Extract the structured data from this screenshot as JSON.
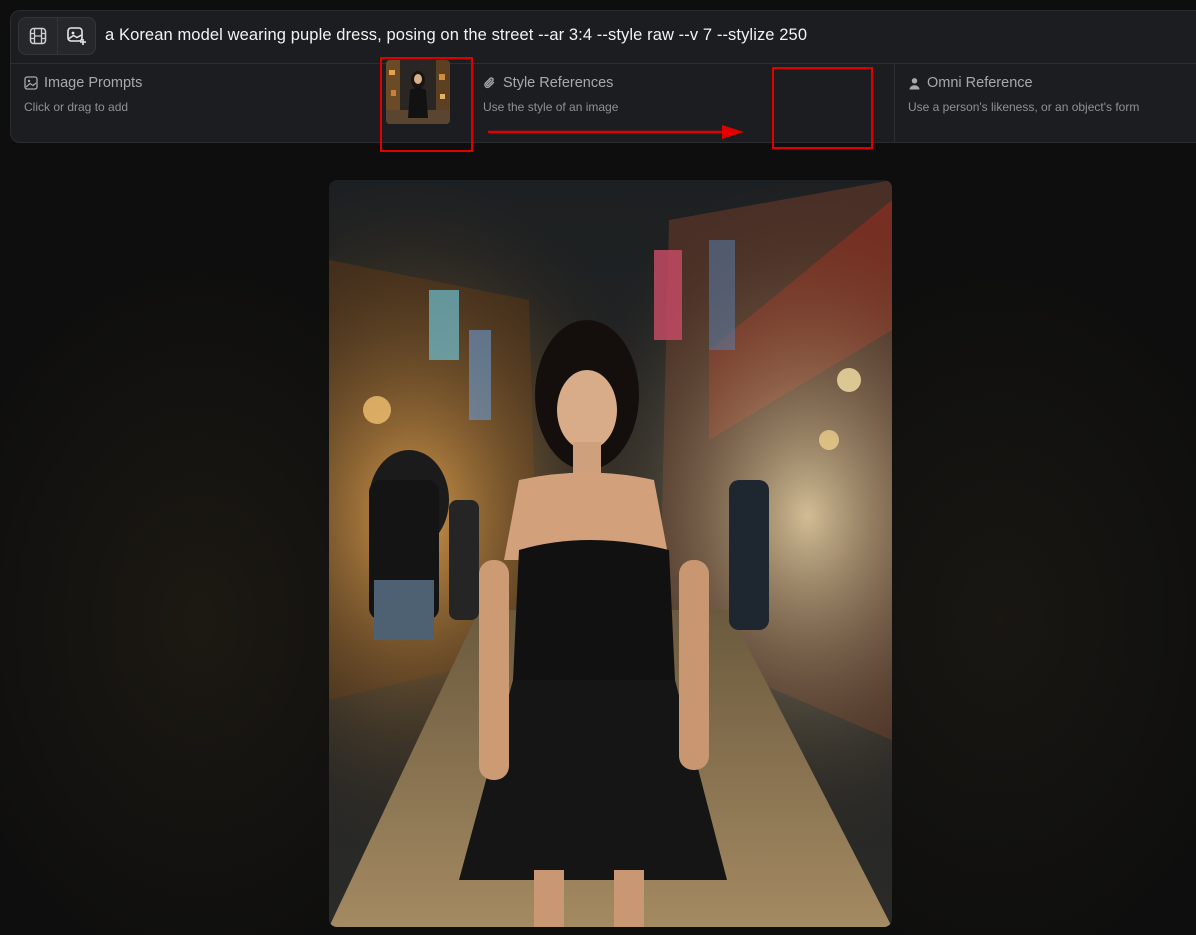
{
  "prompt": {
    "text": "a Korean model wearing puple dress, posing on the street --ar 3:4 --style raw --v 7 --stylize 250"
  },
  "toolbar": {
    "buttons": [
      {
        "icon": "film-frame-icon"
      },
      {
        "icon": "image-add-icon"
      }
    ]
  },
  "references": {
    "image_prompts": {
      "title": "Image Prompts",
      "subtitle": "Click or drag to add",
      "icon": "image-icon"
    },
    "style_references": {
      "title": "Style References",
      "subtitle": "Use the style of an image",
      "icon": "paperclip-icon"
    },
    "omni_reference": {
      "title": "Omni Reference",
      "subtitle": "Use a person's likeness, or an object's form",
      "icon": "person-icon"
    }
  },
  "annotations": {
    "highlight_color": "#e00000"
  },
  "colors": {
    "panel_bg": "#1c1d21",
    "page_bg": "#0e0e0e",
    "text_primary": "#f2f2f2",
    "text_muted": "#8f9196"
  }
}
